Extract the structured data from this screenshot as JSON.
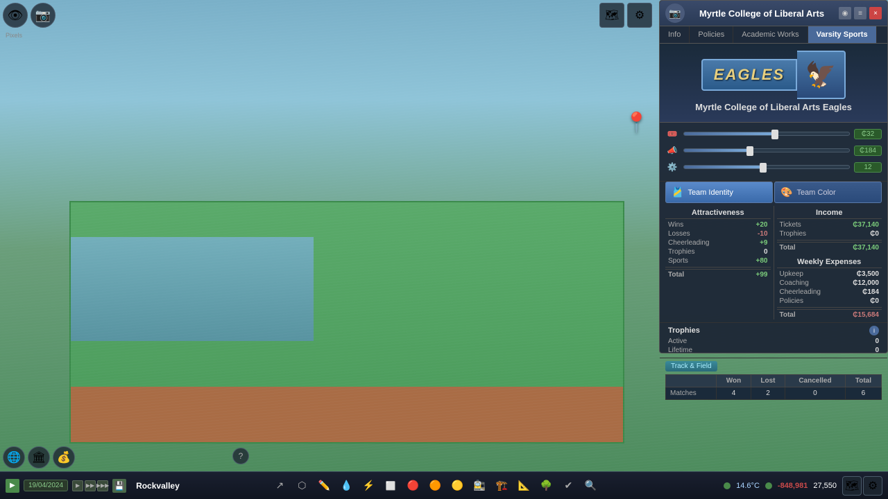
{
  "window": {
    "title": "Myrtle College of Liberal Arts",
    "close_label": "×",
    "map_label": "◉",
    "list_label": "≡"
  },
  "tabs": {
    "info": "Info",
    "policies": "Policies",
    "academic_works": "Academic Works",
    "varsity_sports": "Varsity Sports"
  },
  "team": {
    "name": "Myrtle College of Liberal Arts Eagles",
    "mascot_name": "Eagles",
    "mascot_emoji": "🦅"
  },
  "sliders": [
    {
      "icon": "🏟️",
      "fill_pct": 55,
      "thumb_pct": 55,
      "value": "₵32"
    },
    {
      "icon": "📣",
      "fill_pct": 40,
      "thumb_pct": 40,
      "value": "₵184"
    },
    {
      "icon": "⚙️",
      "fill_pct": 48,
      "thumb_pct": 48,
      "value": "12"
    }
  ],
  "section_buttons": {
    "identity": {
      "label": "Team Identity",
      "icon": "🎽"
    },
    "color": {
      "label": "Team Color",
      "icon": "🎨"
    }
  },
  "attractiveness": {
    "title": "Attractiveness",
    "rows": [
      {
        "label": "Wins",
        "value": "+20",
        "type": "positive"
      },
      {
        "label": "Losses",
        "value": "-10",
        "type": "negative"
      },
      {
        "label": "Cheerleading",
        "value": "+9",
        "type": "positive"
      },
      {
        "label": "Trophies",
        "value": "0",
        "type": "neutral"
      },
      {
        "label": "Sports",
        "value": "+80",
        "type": "positive"
      },
      {
        "label": "Total",
        "value": "+99",
        "type": "positive"
      }
    ]
  },
  "income": {
    "title": "Income",
    "rows": [
      {
        "label": "Tickets",
        "value": "₵37,140",
        "type": "positive"
      },
      {
        "label": "Trophies",
        "value": "₵0",
        "type": "neutral"
      },
      {
        "label": "Total",
        "value": "₵37,140",
        "type": "positive"
      }
    ]
  },
  "weekly_expenses": {
    "title": "Weekly Expenses",
    "rows": [
      {
        "label": "Upkeep",
        "value": "₵3,500"
      },
      {
        "label": "Coaching",
        "value": "₵12,000"
      },
      {
        "label": "Cheerleading",
        "value": "₵184"
      },
      {
        "label": "Policies",
        "value": "₵0"
      },
      {
        "label": "Total",
        "value": "₵15,684"
      }
    ]
  },
  "trophies": {
    "title": "Trophies",
    "active_label": "Active",
    "lifetime_label": "Lifetime",
    "active_value": "0",
    "lifetime_value": "0"
  },
  "track_field": {
    "label": "Track & Field",
    "table_headers": [
      "",
      "Won",
      "Lost",
      "Cancelled",
      "Total"
    ],
    "rows": [
      {
        "label": "Matches",
        "won": "4",
        "lost": "2",
        "cancelled": "0",
        "total": "6"
      }
    ]
  },
  "taskbar": {
    "play_icon": "▶",
    "date": "19/04/2024",
    "city": "Rockvalley",
    "temperature": "14.6°C",
    "money": "-848,981",
    "population": "27,550",
    "tools": [
      "↗",
      "⬡",
      "✏",
      "💧",
      "⚡",
      "🔧",
      "📦",
      "🚗",
      "🚉",
      "🏗",
      "📐",
      "🌳",
      "✔",
      "🔍"
    ]
  },
  "topleft": {
    "icon1": "👁",
    "icon2": "📷"
  },
  "topright": {
    "icon1": "🗺",
    "icon2": "⚙"
  }
}
